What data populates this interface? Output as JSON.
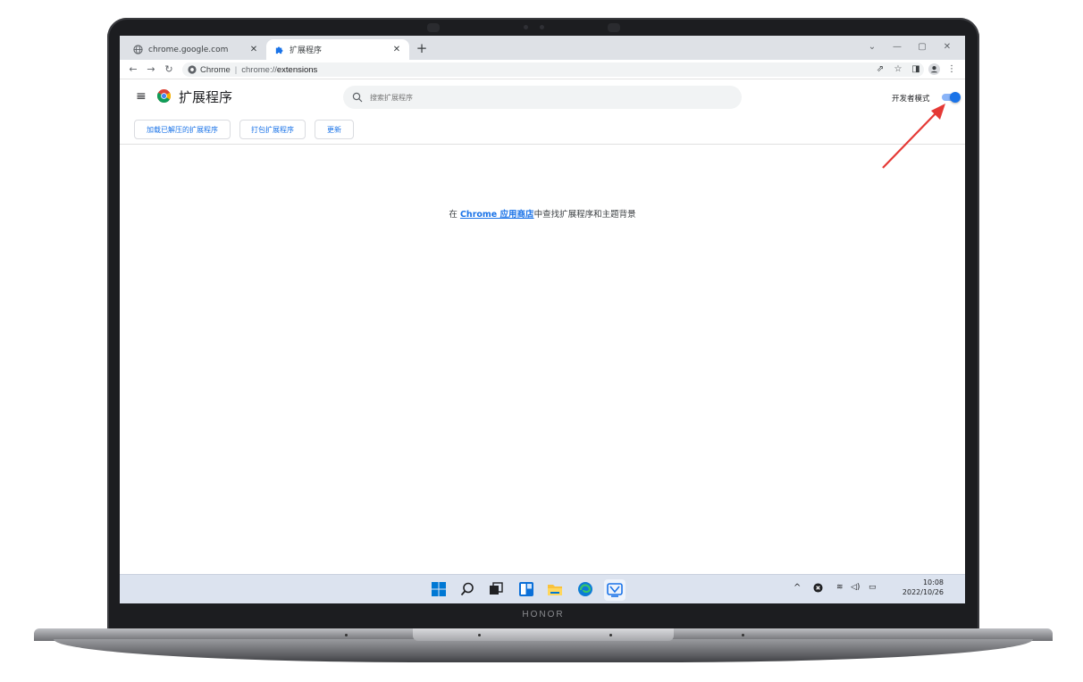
{
  "device": {
    "brand": "HONOR"
  },
  "browser": {
    "tabs": [
      {
        "title": "chrome.google.com",
        "icon": "globe-icon",
        "active": false
      },
      {
        "title": "扩展程序",
        "icon": "puzzle-icon",
        "active": true
      }
    ],
    "address_bar": {
      "site_chip": "Chrome",
      "url_scheme": "chrome://",
      "url_path": "extensions"
    }
  },
  "extensions_page": {
    "title": "扩展程序",
    "search_placeholder": "搜索扩展程序",
    "developer_mode_label": "开发者模式",
    "developer_mode_enabled": true,
    "buttons": {
      "load_unpacked": "加载已解压的扩展程序",
      "pack": "打包扩展程序",
      "update": "更新"
    },
    "empty_state": {
      "prefix": "在 ",
      "link": "Chrome 应用商店",
      "suffix": "中查找扩展程序和主题背景"
    }
  },
  "taskbar": {
    "apps": [
      "windows-start-icon",
      "search-icon",
      "task-view-icon",
      "widgets-icon",
      "file-explorer-icon",
      "edge-icon",
      "app-icon"
    ],
    "time": "10:08",
    "date": "2022/10/26"
  },
  "colors": {
    "accent": "#1a73e8",
    "toggle_track": "#8ab4f8",
    "annotation_arrow": "#e53935"
  }
}
